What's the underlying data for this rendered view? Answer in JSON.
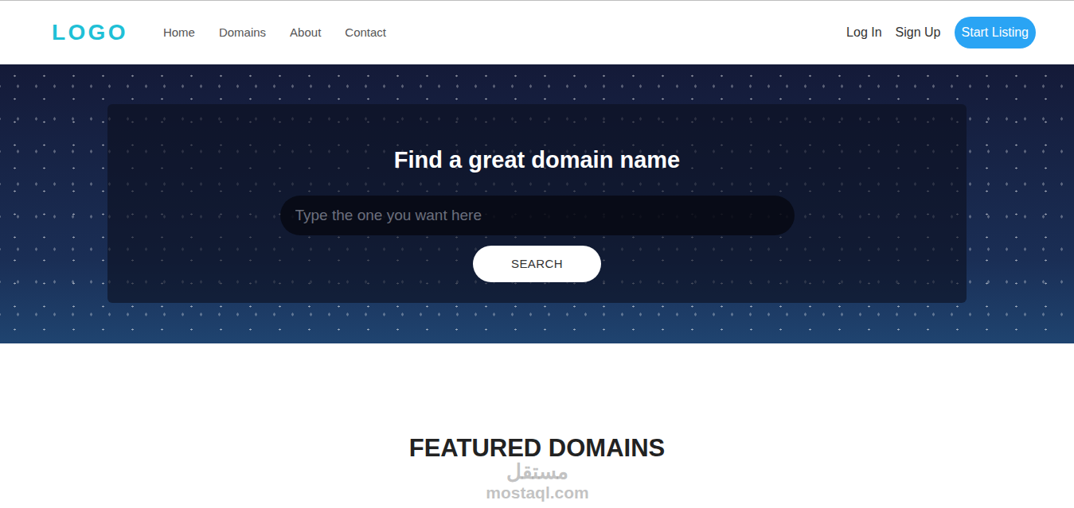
{
  "nav": {
    "logo": "LOGO",
    "links": [
      {
        "label": "Home"
      },
      {
        "label": "Domains"
      },
      {
        "label": "About"
      },
      {
        "label": "Contact"
      }
    ],
    "auth": [
      {
        "label": "Log In"
      },
      {
        "label": "Sign Up"
      }
    ],
    "cta": "Start Listing"
  },
  "hero": {
    "title": "Find a great domain name",
    "search": {
      "placeholder": "Type the one you want here"
    },
    "button": "SEARCH"
  },
  "featured": {
    "title": "FEATURED DOMAINS"
  },
  "watermark": {
    "arabic": "مستقل",
    "latin": "mostaql.com"
  }
}
